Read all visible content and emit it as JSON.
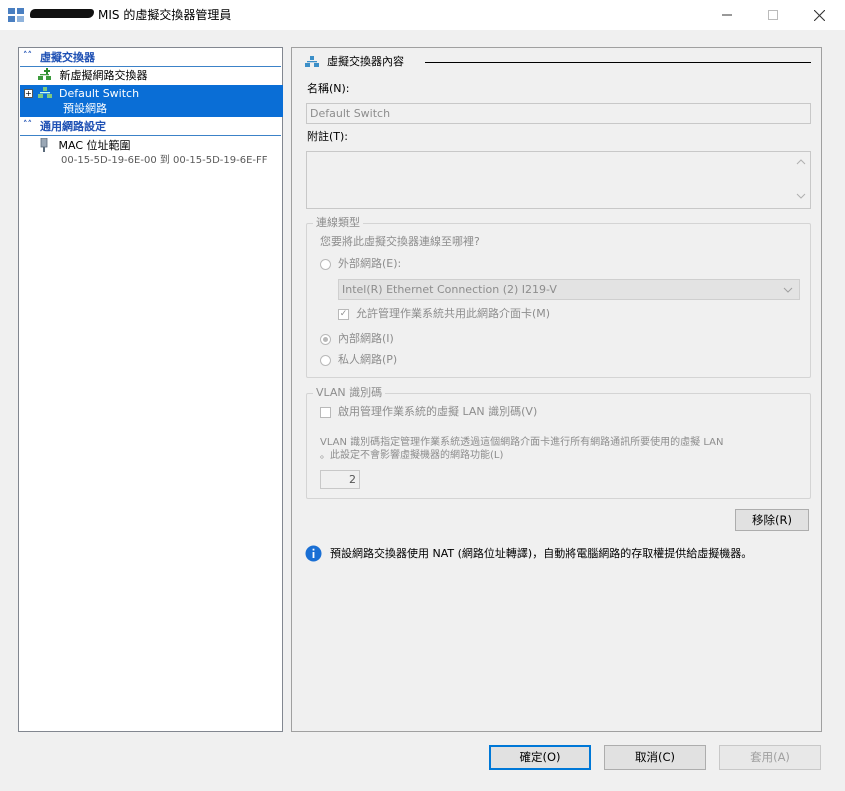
{
  "window": {
    "title": "MIS 的虛擬交換器管理員",
    "minimize_icon": "minimize-icon",
    "maximize_icon": "maximize-icon",
    "close_icon": "close-icon"
  },
  "tree": {
    "section_switches": "虛擬交換器",
    "new_switch": "新虛擬網路交換器",
    "switch_name": "Default Switch",
    "switch_sub": "預設網路",
    "section_global": "通用網路設定",
    "mac_label": "MAC 位址範圍",
    "mac_range": "00-15-5D-19-6E-00 到 00-15-5D-19-6E-FF"
  },
  "props": {
    "section_title": "虛擬交換器內容",
    "name_label": "名稱(N):",
    "name_value": "Default Switch",
    "notes_label": "附註(T):",
    "notes_value": "",
    "conn_group": "連線類型",
    "conn_question": "您要將此虛擬交換器連線至哪裡?",
    "external_label": "外部網路(E):",
    "adapter_value": "Intel(R) Ethernet Connection (2) I219-V",
    "allow_mgmt_label": "允許管理作業系統共用此網路介面卡(M)",
    "internal_label": "內部網路(I)",
    "private_label": "私人網路(P)",
    "selected_connection": "internal",
    "vlan_group": "VLAN 識別碼",
    "vlan_enable_label": "啟用管理作業系統的虛擬 LAN 識別碼(V)",
    "vlan_desc_line1": "VLAN 識別碼指定管理作業系統透過這個網路介面卡進行所有網路通訊所要使用的虛擬 LAN",
    "vlan_desc_line2": "。此設定不會影響虛擬機器的網路功能(L)",
    "vlan_id_value": "2",
    "remove_button": "移除(R)",
    "info_text": "預設網路交換器使用 NAT (網路位址轉譯)，自動將電腦網路的存取權提供給虛擬機器。"
  },
  "footer": {
    "ok": "確定(O)",
    "cancel": "取消(C)",
    "apply": "套用(A)"
  },
  "colors": {
    "selection": "#0a6ed6",
    "header_text": "#1e50b4",
    "info_icon": "#1a6fd4",
    "disabled_text": "#8d8d8d"
  }
}
